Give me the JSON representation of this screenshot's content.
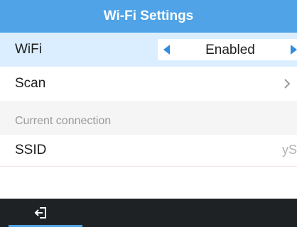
{
  "header": {
    "title": "Wi-Fi Settings"
  },
  "wifi": {
    "label": "WiFi",
    "value": "Enabled"
  },
  "scan": {
    "label": "Scan"
  },
  "section": {
    "label": "Current connection"
  },
  "ssid": {
    "label": "SSID",
    "value": "yS"
  },
  "footer": {
    "exit_icon": "exit-icon"
  },
  "colors": {
    "title_bar": "#4fa3e6",
    "selected_row": "#dbeeff",
    "arrow": "#2f8de0",
    "bottom_bar": "#1f2224"
  }
}
